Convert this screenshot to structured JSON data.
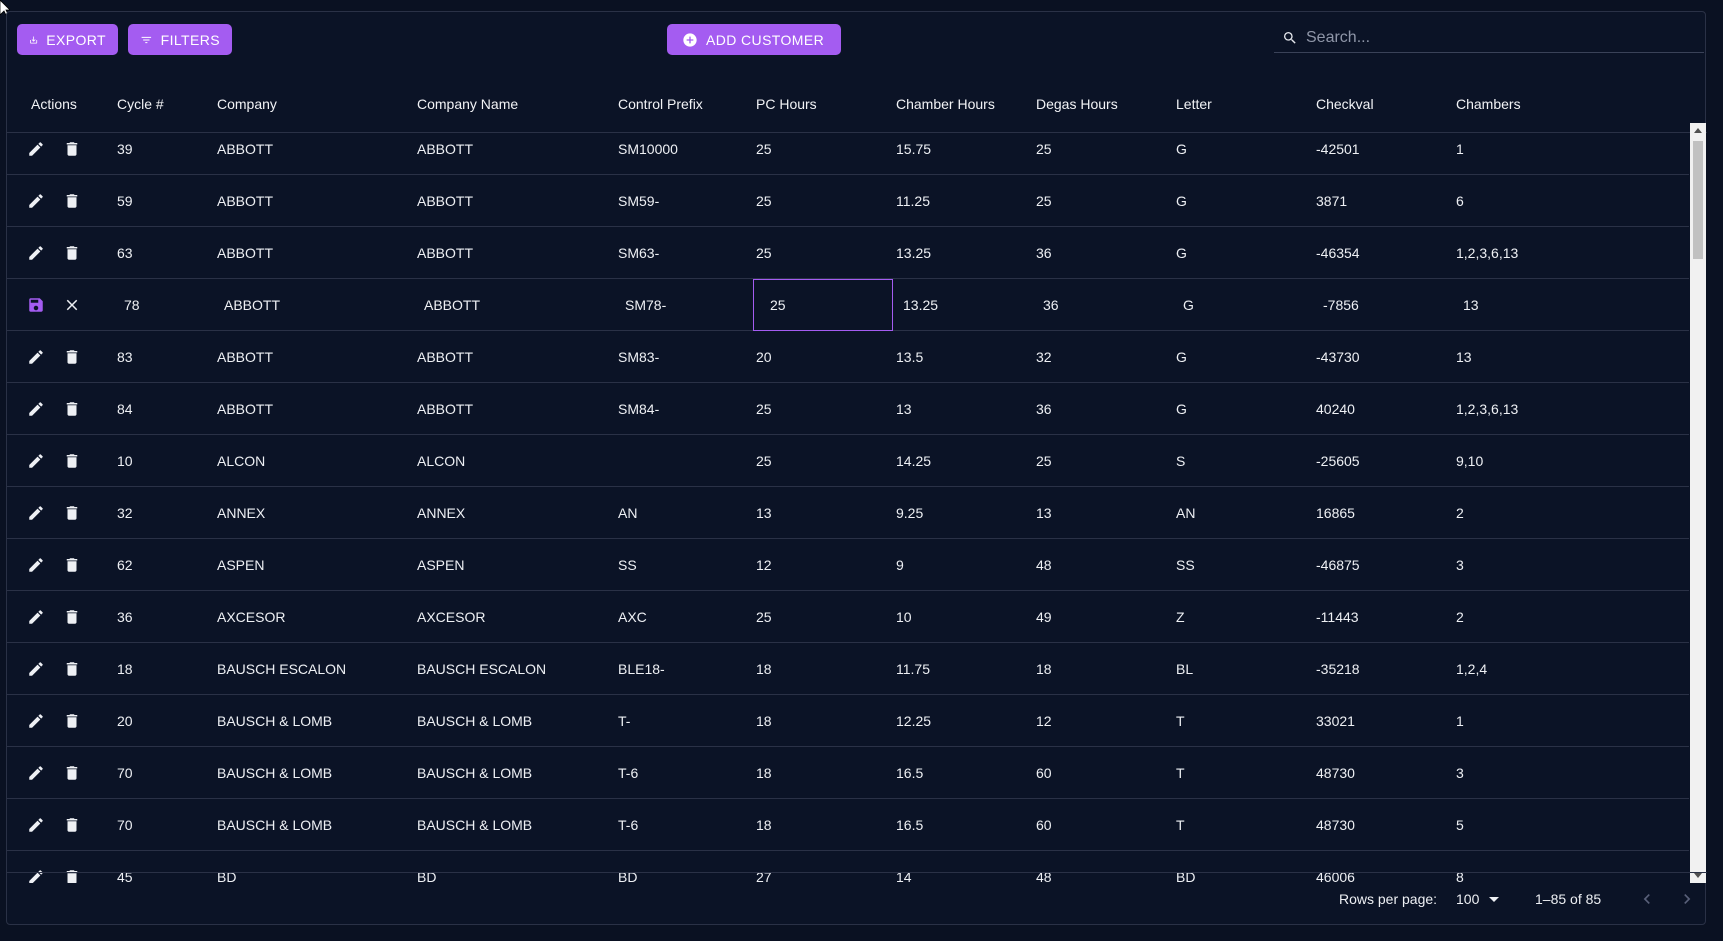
{
  "toolbar": {
    "export_label": "EXPORT",
    "filters_label": "FILTERS",
    "add_label": "ADD CUSTOMER",
    "search_placeholder": "Search..."
  },
  "columns": [
    "Actions",
    "Cycle #",
    "Company",
    "Company Name",
    "Control Prefix",
    "PC Hours",
    "Chamber Hours",
    "Degas Hours",
    "Letter",
    "Checkval",
    "Chambers"
  ],
  "rows": [
    {
      "mode": "view",
      "cells": [
        "39",
        "ABBOTT",
        "ABBOTT",
        "SM10000",
        "25",
        "15.75",
        "25",
        "G",
        "-42501",
        "1"
      ]
    },
    {
      "mode": "view",
      "cells": [
        "59",
        "ABBOTT",
        "ABBOTT",
        "SM59-",
        "25",
        "11.25",
        "25",
        "G",
        "3871",
        "6"
      ]
    },
    {
      "mode": "view",
      "cells": [
        "63",
        "ABBOTT",
        "ABBOTT",
        "SM63-",
        "25",
        "13.25",
        "36",
        "G",
        "-46354",
        "1,2,3,6,13"
      ]
    },
    {
      "mode": "edit",
      "cells": [
        "78",
        "ABBOTT",
        "ABBOTT",
        "SM78-",
        "25",
        "13.25",
        "36",
        "G",
        "-7856",
        "13"
      ]
    },
    {
      "mode": "view",
      "cells": [
        "83",
        "ABBOTT",
        "ABBOTT",
        "SM83-",
        "20",
        "13.5",
        "32",
        "G",
        "-43730",
        "13"
      ]
    },
    {
      "mode": "view",
      "cells": [
        "84",
        "ABBOTT",
        "ABBOTT",
        "SM84-",
        "25",
        "13",
        "36",
        "G",
        "40240",
        "1,2,3,6,13"
      ]
    },
    {
      "mode": "view",
      "cells": [
        "10",
        "ALCON",
        "ALCON",
        "",
        "25",
        "14.25",
        "25",
        "S",
        "-25605",
        "9,10"
      ]
    },
    {
      "mode": "view",
      "cells": [
        "32",
        "ANNEX",
        "ANNEX",
        "AN",
        "13",
        "9.25",
        "13",
        "AN",
        "16865",
        "2"
      ]
    },
    {
      "mode": "view",
      "cells": [
        "62",
        "ASPEN",
        "ASPEN",
        "SS",
        "12",
        "9",
        "48",
        "SS",
        "-46875",
        "3"
      ]
    },
    {
      "mode": "view",
      "cells": [
        "36",
        "AXCESOR",
        "AXCESOR",
        "AXC",
        "25",
        "10",
        "49",
        "Z",
        "-11443",
        "2"
      ]
    },
    {
      "mode": "view",
      "cells": [
        "18",
        "BAUSCH ESCALON",
        "BAUSCH ESCALON",
        "BLE18-",
        "18",
        "11.75",
        "18",
        "BL",
        "-35218",
        "1,2,4"
      ]
    },
    {
      "mode": "view",
      "cells": [
        "20",
        "BAUSCH & LOMB",
        "BAUSCH & LOMB",
        "T-",
        "18",
        "12.25",
        "12",
        "T",
        "33021",
        "1"
      ]
    },
    {
      "mode": "view",
      "cells": [
        "70",
        "BAUSCH & LOMB",
        "BAUSCH & LOMB",
        "T-6",
        "18",
        "16.5",
        "60",
        "T",
        "48730",
        "3"
      ]
    },
    {
      "mode": "view",
      "cells": [
        "70",
        "BAUSCH & LOMB",
        "BAUSCH & LOMB",
        "T-6",
        "18",
        "16.5",
        "60",
        "T",
        "48730",
        "5"
      ]
    },
    {
      "mode": "view",
      "cells": [
        "45",
        "BD",
        "BD",
        "BD",
        "27",
        "14",
        "48",
        "BD",
        "46006",
        "8"
      ]
    }
  ],
  "footer": {
    "rows_per_page_label": "Rows per page:",
    "rows_per_page_value": "100",
    "range_text": "1–85 of 85"
  }
}
